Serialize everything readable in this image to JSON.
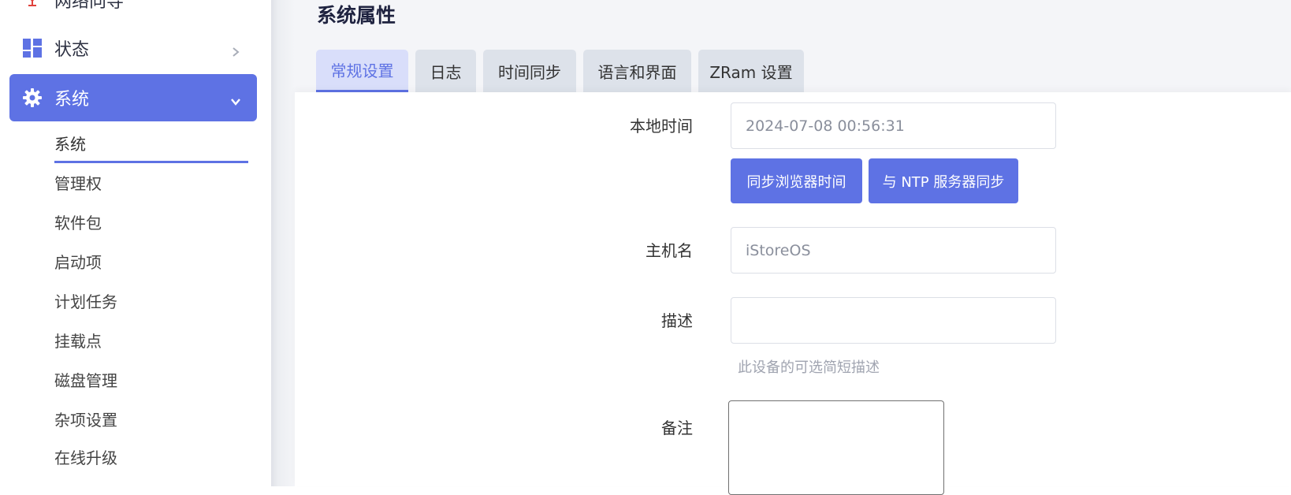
{
  "sidebar": {
    "partial_item": {
      "label": "网络向导",
      "icon": "network-wizard-icon"
    },
    "status": {
      "label": "状态",
      "icon": "dashboard-icon"
    },
    "system": {
      "label": "系统",
      "icon": "gear-icon"
    },
    "sub_items": [
      {
        "label": "系统"
      },
      {
        "label": "管理权"
      },
      {
        "label": "软件包"
      },
      {
        "label": "启动项"
      },
      {
        "label": "计划任务"
      },
      {
        "label": "挂载点"
      },
      {
        "label": "磁盘管理"
      },
      {
        "label": "杂项设置"
      },
      {
        "label": "在线升级"
      }
    ]
  },
  "main": {
    "title": "系统属性",
    "tabs": [
      {
        "label": "常规设置",
        "active": true
      },
      {
        "label": "日志"
      },
      {
        "label": "时间同步"
      },
      {
        "label": "语言和界面"
      },
      {
        "label": "ZRam 设置"
      }
    ],
    "local_time": {
      "label": "本地时间",
      "value": "2024-07-08 00:56:31"
    },
    "buttons": {
      "sync_browser": "同步浏览器时间",
      "sync_ntp": "与 NTP 服务器同步"
    },
    "hostname": {
      "label": "主机名",
      "value": "iStoreOS"
    },
    "description": {
      "label": "描述",
      "value": "",
      "hint": "此设备的可选简短描述"
    },
    "notes": {
      "label": "备注"
    }
  },
  "colors": {
    "accent": "#5e72e4",
    "tab_bg": "#dde2ea",
    "active_tab_bg": "#d9defa"
  }
}
